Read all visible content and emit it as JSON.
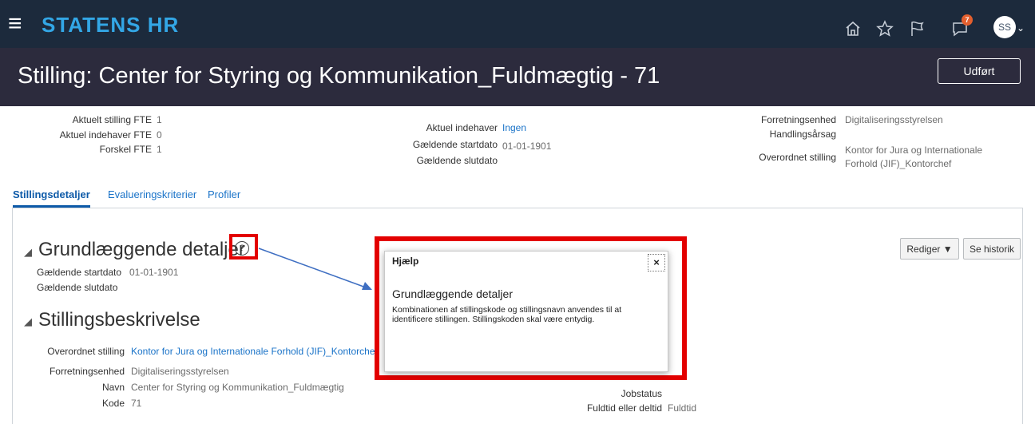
{
  "header": {
    "brand": "STATENS HR",
    "menu_icon": "hamburger-icon",
    "notification_count": "7",
    "avatar_initials": "SS"
  },
  "title_bar": {
    "title": "Stilling: Center for Styring og Kommunikation_Fuldmægtig - 71",
    "done_label": "Udført"
  },
  "summary": {
    "col1": [
      {
        "label": "Aktuelt stilling FTE",
        "value": "1"
      },
      {
        "label": "Aktuel indehaver FTE",
        "value": "0"
      },
      {
        "label": "Forskel FTE",
        "value": "1"
      }
    ],
    "col2": [
      {
        "label": "Aktuel indehaver",
        "value": "Ingen"
      },
      {
        "label": "Gældende startdato",
        "value": "01-01-1901"
      },
      {
        "label": "Gældende slutdato",
        "value": ""
      }
    ],
    "col3": [
      {
        "label": "Forretningsenhed",
        "value": "Digitaliseringsstyrelsen"
      },
      {
        "label": "Handlingsårsag",
        "value": ""
      },
      {
        "label": "Overordnet stilling",
        "value_line1": "Kontor for Jura og Internationale",
        "value_line2": "Forhold (JIF)_Kontorchef"
      }
    ]
  },
  "tabs": [
    "Stillingsdetaljer",
    "Evalueringskriterier",
    "Profiler"
  ],
  "basic_details": {
    "heading": "Grundlæggende detaljer",
    "rows": [
      {
        "label": "Gældende startdato",
        "value": "01-01-1901"
      },
      {
        "label": "Gældende slutdato",
        "value": ""
      }
    ],
    "edit_label": "Rediger ▼",
    "history_label": "Se historik"
  },
  "description": {
    "heading": "Stillingsbeskrivelse",
    "rows": [
      {
        "label": "Overordnet stilling",
        "value": "Kontor for Jura og Internationale Forhold (JIF)_Kontorchef"
      },
      {
        "label": "Forretningsenhed",
        "value": "Digitaliseringsstyrelsen"
      },
      {
        "label": "Navn",
        "value": "Center for Styring og Kommunikation_Fuldmægtig"
      },
      {
        "label": "Kode",
        "value": "71"
      }
    ],
    "right_rows": [
      {
        "label": "Jobstatus",
        "value": ""
      },
      {
        "label": "Fuldtid eller deltid",
        "value": "Fuldtid"
      }
    ]
  },
  "help_popup": {
    "title": "Hjælp",
    "close_label": "×",
    "heading": "Grundlæggende detaljer",
    "body": "Kombinationen af stillingskode og stillingsnavn anvendes til at identificere stillingen. Stillingskoden skal være entydig."
  },
  "colors": {
    "header_bg": "#1c2a3c",
    "title_bg": "#2c2b3d",
    "brand": "#33a7e6",
    "link": "#1a73c8",
    "highlight": "#e30000",
    "arrow": "#3f6fc2"
  }
}
